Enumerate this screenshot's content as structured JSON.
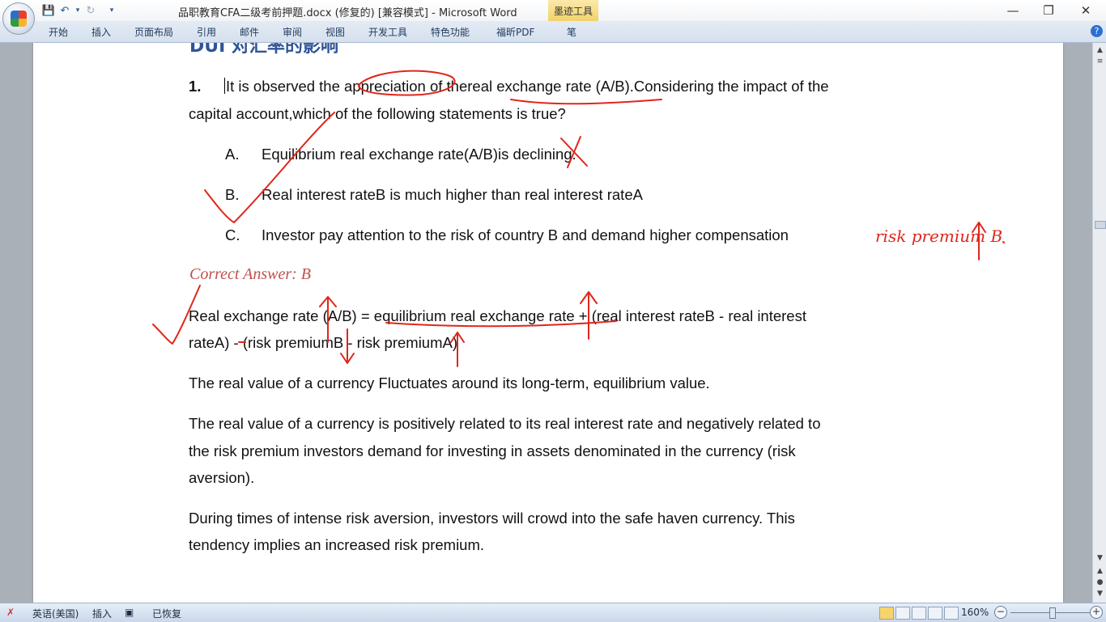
{
  "window": {
    "title": "品职教育CFA二级考前押题.docx (修复的) [兼容模式] - Microsoft Word",
    "context_tab": "墨迹工具"
  },
  "qat": {
    "dropdown_glyph": "▾"
  },
  "ribbon": {
    "tabs": [
      "开始",
      "插入",
      "页面布局",
      "引用",
      "邮件",
      "审阅",
      "视图",
      "开发工具",
      "特色功能",
      "福昕PDF",
      "笔"
    ]
  },
  "document": {
    "heading_fragment": "DUI 对汇率的影响",
    "question": {
      "number": "1.",
      "line1": "It is observed the appreciation of thereal exchange rate (A/B).Considering the impact of the",
      "line2": "capital account,which of the following statements is true?"
    },
    "options": [
      {
        "letter": "A.",
        "text": "Equilibrium real exchange rate(A/B)is declining."
      },
      {
        "letter": "B.",
        "text": "Real interest rateB is much higher than real interest rateA"
      },
      {
        "letter": "C.",
        "text": "Investor pay attention to the risk of country B and demand higher compensation"
      }
    ],
    "correct_answer": "Correct Answer: B",
    "paragraphs": [
      [
        "Real exchange rate (A/B) = equilibrium real exchange rate + (real interest rateB - real interest",
        "rateA) - (risk premiumB - risk premiumA)"
      ],
      [
        "The real value of a currency Fluctuates around its long-term, equilibrium value."
      ],
      [
        "The real value of a currency is positively related to its real interest rate and negatively related to",
        "the risk premium investors demand for investing in assets denominated in the currency (risk",
        "aversion)."
      ],
      [
        "During times of intense risk aversion, investors will crowd into the safe haven currency. This",
        "tendency implies an increased risk premium."
      ]
    ],
    "ink_annotation": "risk premium B"
  },
  "statusbar": {
    "language": "英语(美国)",
    "insert_mode": "插入",
    "recovered": "已恢复",
    "zoom": "160%"
  },
  "colors": {
    "ink": "#e0261b",
    "answer": "#c0504d",
    "heading": "#2f5597"
  }
}
